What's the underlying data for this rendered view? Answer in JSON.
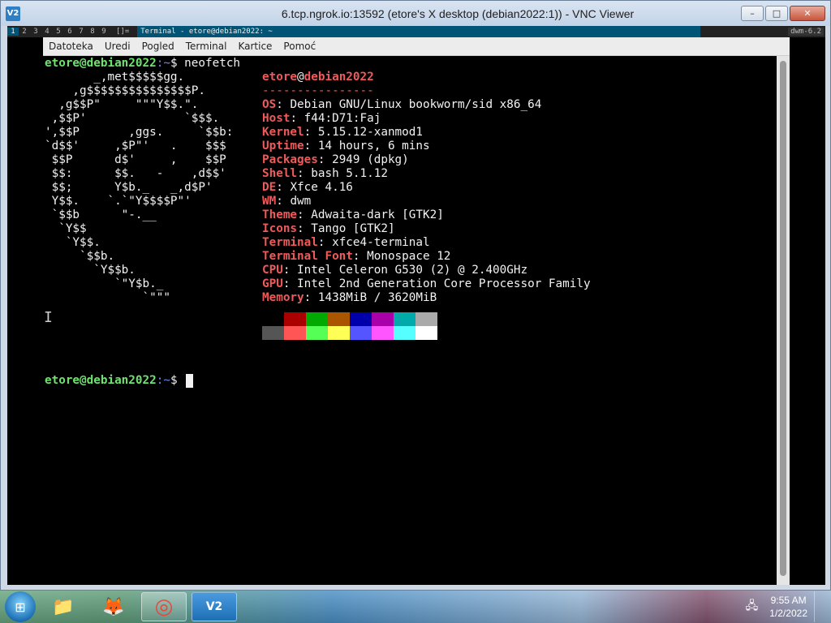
{
  "vnc": {
    "title": "6.tcp.ngrok.io:13592 (etore's X desktop (debian2022:1)) - VNC Viewer",
    "icon": "vnc-icon",
    "icon_text": "V2",
    "minimize": "–",
    "maximize": "□",
    "close": "✕"
  },
  "dwm": {
    "tags": [
      "1",
      "2",
      "3",
      "4",
      "5",
      "6",
      "7",
      "8",
      "9"
    ],
    "layout": "[]=",
    "window_title": "Terminal - etore@debian2022: ~",
    "status": "dwm-6.2"
  },
  "terminal": {
    "menu": [
      "Datoteka",
      "Uredi",
      "Pogled",
      "Terminal",
      "Kartice",
      "Pomoć"
    ],
    "prompt_user": "etore@debian2022",
    "prompt_path": ":~",
    "prompt_symbol": "$ ",
    "command": "neofetch",
    "ascii_logo": [
      "       _,met$$$$$gg.",
      "    ,g$$$$$$$$$$$$$$$P.",
      "  ,g$$P\"     \"\"\"Y$$.\".",
      " ,$$P'              `$$$.",
      "',$$P       ,ggs.     `$$b:",
      "`d$$'     ,$P\"'   .    $$$",
      " $$P      d$'     ,    $$P",
      " $$:      $$.   -    ,d$$'",
      " $$;      Y$b._   _,d$P'",
      " Y$$.    `.`\"Y$$$$P\"'",
      " `$$b      \"-.__",
      "  `Y$$",
      "   `Y$$.",
      "     `$$b.",
      "       `Y$$b.",
      "          `\"Y$b._",
      "              `\"\"\""
    ],
    "info_header_user": "etore",
    "info_header_host": "debian2022",
    "info_separator": "----------------",
    "info": [
      {
        "key": "OS",
        "value": "Debian GNU/Linux bookworm/sid x86_64"
      },
      {
        "key": "Host",
        "value": "f44:D71:Faj"
      },
      {
        "key": "Kernel",
        "value": "5.15.12-xanmod1"
      },
      {
        "key": "Uptime",
        "value": "14 hours, 6 mins"
      },
      {
        "key": "Packages",
        "value": "2949 (dpkg)"
      },
      {
        "key": "Shell",
        "value": "bash 5.1.12"
      },
      {
        "key": "DE",
        "value": "Xfce 4.16"
      },
      {
        "key": "WM",
        "value": "dwm"
      },
      {
        "key": "Theme",
        "value": "Adwaita-dark [GTK2]"
      },
      {
        "key": "Icons",
        "value": "Tango [GTK2]"
      },
      {
        "key": "Terminal",
        "value": "xfce4-terminal"
      },
      {
        "key": "Terminal Font",
        "value": "Monospace 12"
      },
      {
        "key": "CPU",
        "value": "Intel Celeron G530 (2) @ 2.400GHz"
      },
      {
        "key": "GPU",
        "value": "Intel 2nd Generation Core Processor Family"
      },
      {
        "key": "Memory",
        "value": "1438MiB / 3620MiB"
      }
    ],
    "palette_dark": [
      "#000000",
      "#aa0000",
      "#00aa00",
      "#aa5500",
      "#0000aa",
      "#aa00aa",
      "#00aaaa",
      "#aaaaaa"
    ],
    "palette_bright": [
      "#555555",
      "#ff5555",
      "#55ff55",
      "#ffff55",
      "#5555ff",
      "#ff55ff",
      "#55ffff",
      "#ffffff"
    ],
    "colors": {
      "prompt_user": "#6fe36f",
      "prompt_path": "#6b8be8",
      "info_key": "#ef5a5a"
    }
  },
  "taskbar": {
    "start_icon": "windows-orb-icon",
    "pinned": [
      {
        "name": "explorer",
        "icon": "folder-icon",
        "glyph": "📁",
        "active": false
      },
      {
        "name": "firefox",
        "icon": "firefox-icon",
        "glyph": "🦊",
        "active": false
      },
      {
        "name": "chrome",
        "icon": "chrome-icon",
        "glyph": "◎",
        "active": true
      },
      {
        "name": "vnc-viewer",
        "icon": "vnc-viewer-icon",
        "glyph": "V2",
        "active": true
      }
    ],
    "tray_icon": "network-icon",
    "tray_glyph": "🖧",
    "time": "9:55 AM",
    "date": "1/2/2022"
  }
}
